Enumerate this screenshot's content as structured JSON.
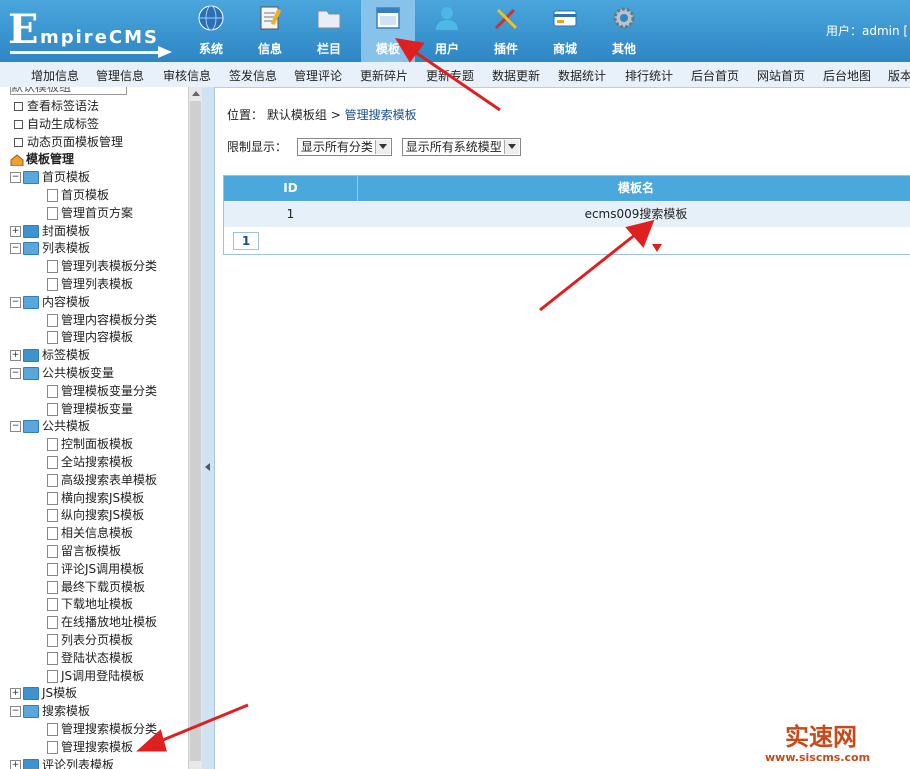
{
  "header": {
    "logo_letter": "E",
    "logo_text": "mpireCMS",
    "nav": [
      {
        "label": "系统",
        "icon": "globe-icon"
      },
      {
        "label": "信息",
        "icon": "notepad-icon"
      },
      {
        "label": "栏目",
        "icon": "folder-icon"
      },
      {
        "label": "模板",
        "icon": "window-icon"
      },
      {
        "label": "用户",
        "icon": "user-icon"
      },
      {
        "label": "插件",
        "icon": "tools-icon"
      },
      {
        "label": "商城",
        "icon": "card-icon"
      },
      {
        "label": "其他",
        "icon": "gear-icon"
      }
    ],
    "active_index": 3,
    "user_info": "用户：admin ["
  },
  "submenu": [
    "增加信息",
    "管理信息",
    "审核信息",
    "签发信息",
    "管理评论",
    "更新碎片",
    "更新专题",
    "数据更新",
    "数据统计",
    "排行统计",
    "后台首页",
    "网站首页",
    "后台地图",
    "版本"
  ],
  "sidebar": {
    "top_partial": "默认模板组",
    "items": [
      {
        "label": "查看标签语法",
        "type": "box"
      },
      {
        "label": "自动生成标签",
        "type": "box"
      },
      {
        "label": "动态页面模板管理",
        "type": "box"
      },
      {
        "label": "模板管理",
        "type": "root"
      },
      {
        "label": "首页模板",
        "type": "folder-open"
      },
      {
        "label": "首页模板",
        "type": "page"
      },
      {
        "label": "管理首页方案",
        "type": "page"
      },
      {
        "label": "封面模板",
        "type": "folder-closed"
      },
      {
        "label": "列表模板",
        "type": "folder-open"
      },
      {
        "label": "管理列表模板分类",
        "type": "page"
      },
      {
        "label": "管理列表模板",
        "type": "page"
      },
      {
        "label": "内容模板",
        "type": "folder-open"
      },
      {
        "label": "管理内容模板分类",
        "type": "page"
      },
      {
        "label": "管理内容模板",
        "type": "page"
      },
      {
        "label": "标签模板",
        "type": "folder-closed"
      },
      {
        "label": "公共模板变量",
        "type": "folder-open"
      },
      {
        "label": "管理模板变量分类",
        "type": "page"
      },
      {
        "label": "管理模板变量",
        "type": "page"
      },
      {
        "label": "公共模板",
        "type": "folder-open"
      },
      {
        "label": "控制面板模板",
        "type": "page"
      },
      {
        "label": "全站搜索模板",
        "type": "page"
      },
      {
        "label": "高级搜索表单模板",
        "type": "page"
      },
      {
        "label": "横向搜索JS模板",
        "type": "page"
      },
      {
        "label": "纵向搜索JS模板",
        "type": "page"
      },
      {
        "label": "相关信息模板",
        "type": "page"
      },
      {
        "label": "留言板模板",
        "type": "page"
      },
      {
        "label": "评论JS调用模板",
        "type": "page"
      },
      {
        "label": "最终下载页模板",
        "type": "page"
      },
      {
        "label": "下载地址模板",
        "type": "page"
      },
      {
        "label": "在线播放地址模板",
        "type": "page"
      },
      {
        "label": "列表分页模板",
        "type": "page"
      },
      {
        "label": "登陆状态模板",
        "type": "page"
      },
      {
        "label": "JS调用登陆模板",
        "type": "page"
      },
      {
        "label": "JS模板",
        "type": "folder-closed"
      },
      {
        "label": "搜索模板",
        "type": "folder-open"
      },
      {
        "label": "管理搜索模板分类",
        "type": "page"
      },
      {
        "label": "管理搜索模板",
        "type": "page"
      },
      {
        "label": "评论列表模板",
        "type": "folder-closed"
      }
    ]
  },
  "main": {
    "breadcrumb_prefix": "位置：",
    "breadcrumb_group": "默认模板组",
    "breadcrumb_sep": " > ",
    "breadcrumb_current": "管理搜索模板",
    "filter_label": "限制显示：",
    "filter_category": "显示所有分类",
    "filter_model": "显示所有系统模型",
    "table": {
      "headers": [
        "ID",
        "模板名"
      ],
      "rows": [
        [
          "1",
          "ecms009搜索模板"
        ]
      ]
    },
    "page_number": "1"
  },
  "watermark": {
    "title": "实速网",
    "url": "www.siscms.com"
  },
  "colors": {
    "header": "#2e86c4",
    "active_tab": "#86c2ea",
    "table_header": "#4aa8dc",
    "annotation": "#e02020"
  }
}
